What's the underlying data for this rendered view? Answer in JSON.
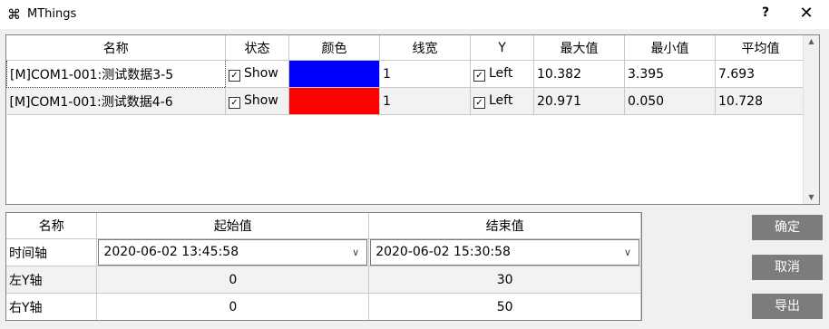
{
  "window": {
    "title": "MThings",
    "icon": "command-icon",
    "help_label": "?",
    "close_label": "✕"
  },
  "series_table": {
    "headers": [
      "名称",
      "状态",
      "颜色",
      "线宽",
      "Y",
      "最大值",
      "最小值",
      "平均值"
    ],
    "rows": [
      {
        "name": "[M]COM1-001:测试数据3-5",
        "state": "Show",
        "color": "#0000ff",
        "width": "1",
        "y_axis": "Left",
        "max": "10.382",
        "min": "3.395",
        "avg": "7.693"
      },
      {
        "name": "[M]COM1-001:测试数据4-6",
        "state": "Show",
        "color": "#ff0000",
        "width": "1",
        "y_axis": "Left",
        "max": "20.971",
        "min": "0.050",
        "avg": "10.728"
      }
    ]
  },
  "range_table": {
    "headers": [
      "名称",
      "起始值",
      "结束值"
    ],
    "rows": [
      {
        "label": "时间轴",
        "start": "2020-06-02 13:45:58",
        "end": "2020-06-02 15:30:58"
      },
      {
        "label": "左Y轴",
        "start": "0",
        "end": "30"
      },
      {
        "label": "右Y轴",
        "start": "0",
        "end": "50"
      }
    ]
  },
  "buttons": {
    "ok": "确定",
    "cancel": "取消",
    "export": "导出"
  }
}
